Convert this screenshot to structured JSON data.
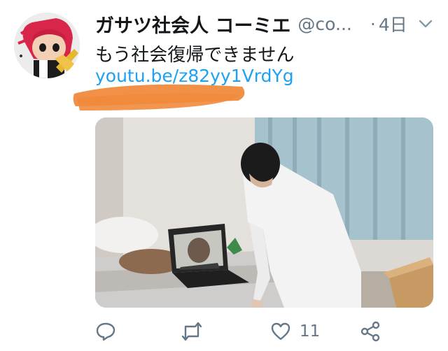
{
  "tweet": {
    "display_name": "ガサツ社会人 コーミエ",
    "handle": "@co...",
    "separator": "·",
    "time": "4日",
    "text": "もう社会復帰できません",
    "link": "youtu.be/z82yy1VrdYg"
  },
  "actions": {
    "reply_icon": "reply-icon",
    "retweet_icon": "retweet-icon",
    "like_icon": "heart-icon",
    "like_count": "11",
    "share_icon": "share-icon"
  },
  "colors": {
    "link": "#1da1f2",
    "secondary": "#657786",
    "scribble": "#f08a3c"
  }
}
